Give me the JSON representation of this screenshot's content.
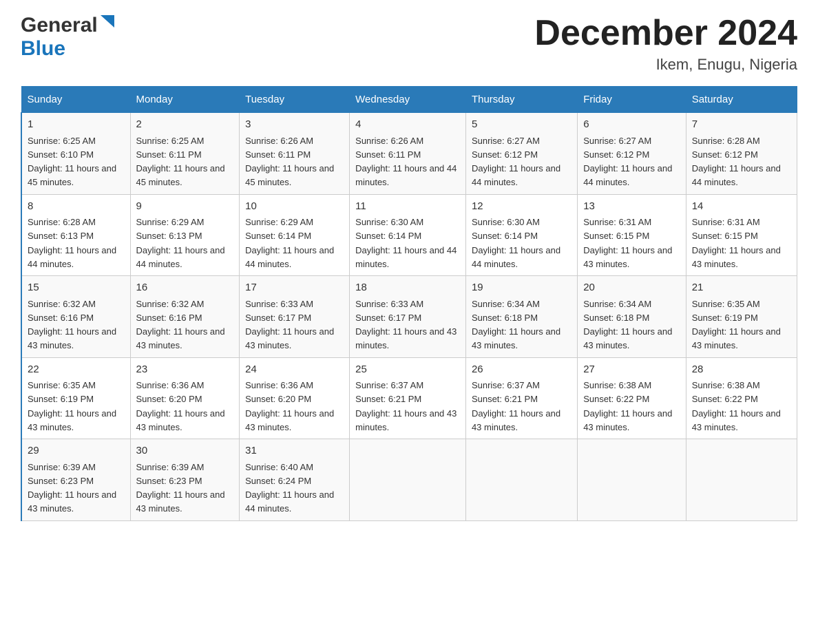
{
  "header": {
    "logo_general": "General",
    "logo_blue": "Blue",
    "month_title": "December 2024",
    "location": "Ikem, Enugu, Nigeria"
  },
  "weekdays": [
    "Sunday",
    "Monday",
    "Tuesday",
    "Wednesday",
    "Thursday",
    "Friday",
    "Saturday"
  ],
  "weeks": [
    [
      {
        "day": "1",
        "sunrise": "6:25 AM",
        "sunset": "6:10 PM",
        "daylight": "11 hours and 45 minutes."
      },
      {
        "day": "2",
        "sunrise": "6:25 AM",
        "sunset": "6:11 PM",
        "daylight": "11 hours and 45 minutes."
      },
      {
        "day": "3",
        "sunrise": "6:26 AM",
        "sunset": "6:11 PM",
        "daylight": "11 hours and 45 minutes."
      },
      {
        "day": "4",
        "sunrise": "6:26 AM",
        "sunset": "6:11 PM",
        "daylight": "11 hours and 44 minutes."
      },
      {
        "day": "5",
        "sunrise": "6:27 AM",
        "sunset": "6:12 PM",
        "daylight": "11 hours and 44 minutes."
      },
      {
        "day": "6",
        "sunrise": "6:27 AM",
        "sunset": "6:12 PM",
        "daylight": "11 hours and 44 minutes."
      },
      {
        "day": "7",
        "sunrise": "6:28 AM",
        "sunset": "6:12 PM",
        "daylight": "11 hours and 44 minutes."
      }
    ],
    [
      {
        "day": "8",
        "sunrise": "6:28 AM",
        "sunset": "6:13 PM",
        "daylight": "11 hours and 44 minutes."
      },
      {
        "day": "9",
        "sunrise": "6:29 AM",
        "sunset": "6:13 PM",
        "daylight": "11 hours and 44 minutes."
      },
      {
        "day": "10",
        "sunrise": "6:29 AM",
        "sunset": "6:14 PM",
        "daylight": "11 hours and 44 minutes."
      },
      {
        "day": "11",
        "sunrise": "6:30 AM",
        "sunset": "6:14 PM",
        "daylight": "11 hours and 44 minutes."
      },
      {
        "day": "12",
        "sunrise": "6:30 AM",
        "sunset": "6:14 PM",
        "daylight": "11 hours and 44 minutes."
      },
      {
        "day": "13",
        "sunrise": "6:31 AM",
        "sunset": "6:15 PM",
        "daylight": "11 hours and 43 minutes."
      },
      {
        "day": "14",
        "sunrise": "6:31 AM",
        "sunset": "6:15 PM",
        "daylight": "11 hours and 43 minutes."
      }
    ],
    [
      {
        "day": "15",
        "sunrise": "6:32 AM",
        "sunset": "6:16 PM",
        "daylight": "11 hours and 43 minutes."
      },
      {
        "day": "16",
        "sunrise": "6:32 AM",
        "sunset": "6:16 PM",
        "daylight": "11 hours and 43 minutes."
      },
      {
        "day": "17",
        "sunrise": "6:33 AM",
        "sunset": "6:17 PM",
        "daylight": "11 hours and 43 minutes."
      },
      {
        "day": "18",
        "sunrise": "6:33 AM",
        "sunset": "6:17 PM",
        "daylight": "11 hours and 43 minutes."
      },
      {
        "day": "19",
        "sunrise": "6:34 AM",
        "sunset": "6:18 PM",
        "daylight": "11 hours and 43 minutes."
      },
      {
        "day": "20",
        "sunrise": "6:34 AM",
        "sunset": "6:18 PM",
        "daylight": "11 hours and 43 minutes."
      },
      {
        "day": "21",
        "sunrise": "6:35 AM",
        "sunset": "6:19 PM",
        "daylight": "11 hours and 43 minutes."
      }
    ],
    [
      {
        "day": "22",
        "sunrise": "6:35 AM",
        "sunset": "6:19 PM",
        "daylight": "11 hours and 43 minutes."
      },
      {
        "day": "23",
        "sunrise": "6:36 AM",
        "sunset": "6:20 PM",
        "daylight": "11 hours and 43 minutes."
      },
      {
        "day": "24",
        "sunrise": "6:36 AM",
        "sunset": "6:20 PM",
        "daylight": "11 hours and 43 minutes."
      },
      {
        "day": "25",
        "sunrise": "6:37 AM",
        "sunset": "6:21 PM",
        "daylight": "11 hours and 43 minutes."
      },
      {
        "day": "26",
        "sunrise": "6:37 AM",
        "sunset": "6:21 PM",
        "daylight": "11 hours and 43 minutes."
      },
      {
        "day": "27",
        "sunrise": "6:38 AM",
        "sunset": "6:22 PM",
        "daylight": "11 hours and 43 minutes."
      },
      {
        "day": "28",
        "sunrise": "6:38 AM",
        "sunset": "6:22 PM",
        "daylight": "11 hours and 43 minutes."
      }
    ],
    [
      {
        "day": "29",
        "sunrise": "6:39 AM",
        "sunset": "6:23 PM",
        "daylight": "11 hours and 43 minutes."
      },
      {
        "day": "30",
        "sunrise": "6:39 AM",
        "sunset": "6:23 PM",
        "daylight": "11 hours and 43 minutes."
      },
      {
        "day": "31",
        "sunrise": "6:40 AM",
        "sunset": "6:24 PM",
        "daylight": "11 hours and 44 minutes."
      },
      null,
      null,
      null,
      null
    ]
  ],
  "labels": {
    "sunrise": "Sunrise:",
    "sunset": "Sunset:",
    "daylight": "Daylight:"
  }
}
